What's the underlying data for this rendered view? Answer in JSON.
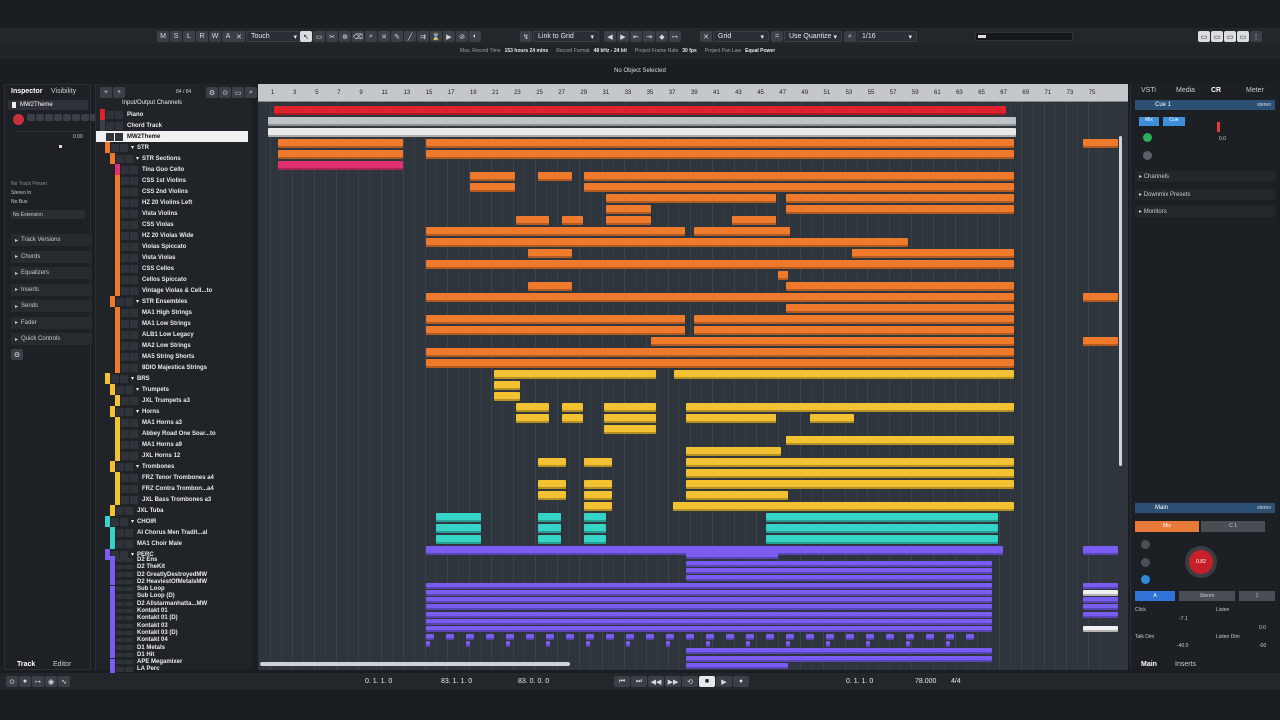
{
  "toolbar": {
    "automation_mode": "Touch",
    "snap_mode": "Link to Grid",
    "grid_type": "Grid",
    "quantize": "Use Quantize",
    "quantize_value": "1/16",
    "tool_letters": [
      "M",
      "S",
      "L",
      "R",
      "W",
      "A"
    ]
  },
  "infoline": {
    "items": [
      {
        "label": "Max. Record Time",
        "value": "153 hours 24 mins"
      },
      {
        "label": "Record Format",
        "value": "48 kHz - 24 bit"
      },
      {
        "label": "Project Frame Rate",
        "value": "30 fps"
      },
      {
        "label": "Project Pan Law",
        "value": "Equal Power"
      }
    ]
  },
  "status": "No Object Selected",
  "inspector": {
    "tabs": [
      "Inspector",
      "Visibility"
    ],
    "track_name": "MW2Theme",
    "no_track_preset": "No Track Preset",
    "routing": [
      "Stereo In",
      "No Bus"
    ],
    "no_extension": "No Extension",
    "sections": [
      "Track Versions",
      "Chords",
      "Equalizers",
      "Inserts",
      "Sends",
      "Fader",
      "Quick Controls"
    ],
    "bottom_tabs": [
      "Track",
      "Editor"
    ],
    "vol_value": "0.00"
  },
  "tracklist": {
    "count": "84 / 84",
    "header": "Input/Output Channels",
    "tracks": [
      {
        "name": "Piano",
        "color": "#e0222c",
        "indent": 0
      },
      {
        "name": "Chord Track",
        "color": "#3b4047",
        "indent": 0
      },
      {
        "name": "MW2Theme",
        "color": "#f1f1f1",
        "indent": 0,
        "selected": true
      },
      {
        "name": "STR",
        "color": "#f07a2c",
        "indent": 1,
        "folder": true
      },
      {
        "name": "STR Sections",
        "color": "#f07a2c",
        "indent": 2,
        "folder": true
      },
      {
        "name": "Tina Guo Cello",
        "color": "#e0306f",
        "indent": 3
      },
      {
        "name": "CSS 1st Violins",
        "color": "#f07a2c",
        "indent": 3
      },
      {
        "name": "CSS 2nd Violins",
        "color": "#f07a2c",
        "indent": 3
      },
      {
        "name": "HZ 20 Violins Left",
        "color": "#f07a2c",
        "indent": 3
      },
      {
        "name": "Vista Violins",
        "color": "#f07a2c",
        "indent": 3
      },
      {
        "name": "CSS Violas",
        "color": "#f07a2c",
        "indent": 3
      },
      {
        "name": "HZ 20 Violas Wide",
        "color": "#f07a2c",
        "indent": 3
      },
      {
        "name": "Violas Spiccato",
        "color": "#f07a2c",
        "indent": 3
      },
      {
        "name": "Vista Violas",
        "color": "#f07a2c",
        "indent": 3
      },
      {
        "name": "CSS Cellos",
        "color": "#f07a2c",
        "indent": 3
      },
      {
        "name": "Cellos Spiccato",
        "color": "#f07a2c",
        "indent": 3
      },
      {
        "name": "Vintage Violas & Cell...to",
        "color": "#f07a2c",
        "indent": 3
      },
      {
        "name": "STR Ensembles",
        "color": "#f07a2c",
        "indent": 2,
        "folder": true
      },
      {
        "name": "MA1 High Strings",
        "color": "#f07a2c",
        "indent": 3
      },
      {
        "name": "MA1 Low Strings",
        "color": "#f07a2c",
        "indent": 3
      },
      {
        "name": "ALB1 Low Legacy",
        "color": "#f07a2c",
        "indent": 3
      },
      {
        "name": "MA2 Low Strings",
        "color": "#f07a2c",
        "indent": 3
      },
      {
        "name": "MA5 String Shorts",
        "color": "#f07a2c",
        "indent": 3
      },
      {
        "name": "8DIO Majestica Strings",
        "color": "#f07a2c",
        "indent": 3
      },
      {
        "name": "BRS",
        "color": "#f2c232",
        "indent": 1,
        "folder": true
      },
      {
        "name": "Trumpets",
        "color": "#f2c232",
        "indent": 2,
        "folder": true
      },
      {
        "name": "JXL Trumpets a3",
        "color": "#f2c232",
        "indent": 3
      },
      {
        "name": "Horns",
        "color": "#f2c232",
        "indent": 2,
        "folder": true
      },
      {
        "name": "MA1 Horns a3",
        "color": "#f2c232",
        "indent": 3
      },
      {
        "name": "Abbey Road One Soar...to",
        "color": "#f2c232",
        "indent": 3
      },
      {
        "name": "MA1 Horns a9",
        "color": "#f2c232",
        "indent": 3
      },
      {
        "name": "JXL Horns 12",
        "color": "#f2c232",
        "indent": 3
      },
      {
        "name": "Trombones",
        "color": "#f2c232",
        "indent": 2,
        "folder": true
      },
      {
        "name": "FRZ Tenor Trombones a4",
        "color": "#f2c232",
        "indent": 3
      },
      {
        "name": "FRZ Contra Trombon...a4",
        "color": "#f2c232",
        "indent": 3
      },
      {
        "name": "JXL Bass Trombones a3",
        "color": "#f2c232",
        "indent": 3
      },
      {
        "name": "JXL Tuba",
        "color": "#f2c232",
        "indent": 2
      },
      {
        "name": "CHOIR",
        "color": "#35d4c6",
        "indent": 1,
        "folder": true
      },
      {
        "name": "AI Chorus Men Tradit...al",
        "color": "#35d4c6",
        "indent": 2
      },
      {
        "name": "MA1 Choir Male",
        "color": "#35d4c6",
        "indent": 2
      },
      {
        "name": "PERC",
        "color": "#7a5cf0",
        "indent": 1,
        "folder": true
      },
      {
        "name": "D2 Ens",
        "color": "#7a5cf0",
        "indent": 2
      },
      {
        "name": "D2 TheKit",
        "color": "#7a5cf0",
        "indent": 2
      },
      {
        "name": "D2 GreatlyDestroyedMW",
        "color": "#7a5cf0",
        "indent": 2
      },
      {
        "name": "D2 HeaviestOfMetalsMW",
        "color": "#7a5cf0",
        "indent": 2
      },
      {
        "name": "Sub Loop",
        "color": "#7a5cf0",
        "indent": 2
      },
      {
        "name": "Sub Loop (D)",
        "color": "#7a5cf0",
        "indent": 2
      },
      {
        "name": "D2 Allstarmanhatta...MW",
        "color": "#7a5cf0",
        "indent": 2
      },
      {
        "name": "Kontakt 01",
        "color": "#7a5cf0",
        "indent": 2
      },
      {
        "name": "Kontakt 01 (D)",
        "color": "#7a5cf0",
        "indent": 2
      },
      {
        "name": "Kontakt 03",
        "color": "#7a5cf0",
        "indent": 2
      },
      {
        "name": "Kontakt 03 (D)",
        "color": "#7a5cf0",
        "indent": 2
      },
      {
        "name": "Kontakt 04",
        "color": "#7a5cf0",
        "indent": 2
      },
      {
        "name": "D1 Metals",
        "color": "#7a5cf0",
        "indent": 2
      },
      {
        "name": "D1 Hit",
        "color": "#7a5cf0",
        "indent": 2
      },
      {
        "name": "APE Megamixer",
        "color": "#7a5cf0",
        "indent": 2
      },
      {
        "name": "LA Perc",
        "color": "#7a5cf0",
        "indent": 2
      }
    ]
  },
  "ruler": [
    "1",
    "3",
    "5",
    "7",
    "9",
    "11",
    "13",
    "15",
    "17",
    "19",
    "21",
    "23",
    "25",
    "27",
    "29",
    "31",
    "33",
    "35",
    "37",
    "39",
    "41",
    "43",
    "45",
    "47",
    "49",
    "51",
    "53",
    "55",
    "57",
    "59",
    "61",
    "63",
    "65",
    "67",
    "69",
    "71",
    "73",
    "75"
  ],
  "rightzone": {
    "tabs": [
      "VSTi",
      "Media",
      "CR",
      "Meter"
    ],
    "cue": "Cue 1",
    "stereo": "stereo",
    "cue_buttons": [
      "Mix",
      "Cue"
    ],
    "folders": [
      "Channels",
      "Downmix Presets",
      "Monitors"
    ],
    "main": "Main",
    "main_buttons": [
      "Mix",
      "C 1"
    ],
    "knob_value": "0.82",
    "out_buttons": [
      "A",
      "Stereo",
      "1"
    ],
    "click": "Click",
    "listen": "Listen",
    "listen_dim": "Listen Dim",
    "talk_dim": "Talk Dim",
    "click_values": [
      "-7.1",
      "0.0"
    ],
    "dim_values": [
      "-40.0",
      "-00"
    ],
    "cue_level": "0.0",
    "bottom_tabs": [
      "Main",
      "Inserts"
    ]
  },
  "transport": {
    "left_locator": "0. 1. 1. 0",
    "right_locator": "83. 1. 1. 0",
    "length": "83. 0. 0. 0",
    "position": "0. 1. 1. 0",
    "tempo": "78.000",
    "signature": "4/4"
  },
  "colors": {
    "strings": "#f07a2c",
    "brass": "#f2c232",
    "choir": "#35d4c6",
    "perc": "#7a5cf0",
    "piano": "#e0222c",
    "cello": "#e0306f"
  }
}
